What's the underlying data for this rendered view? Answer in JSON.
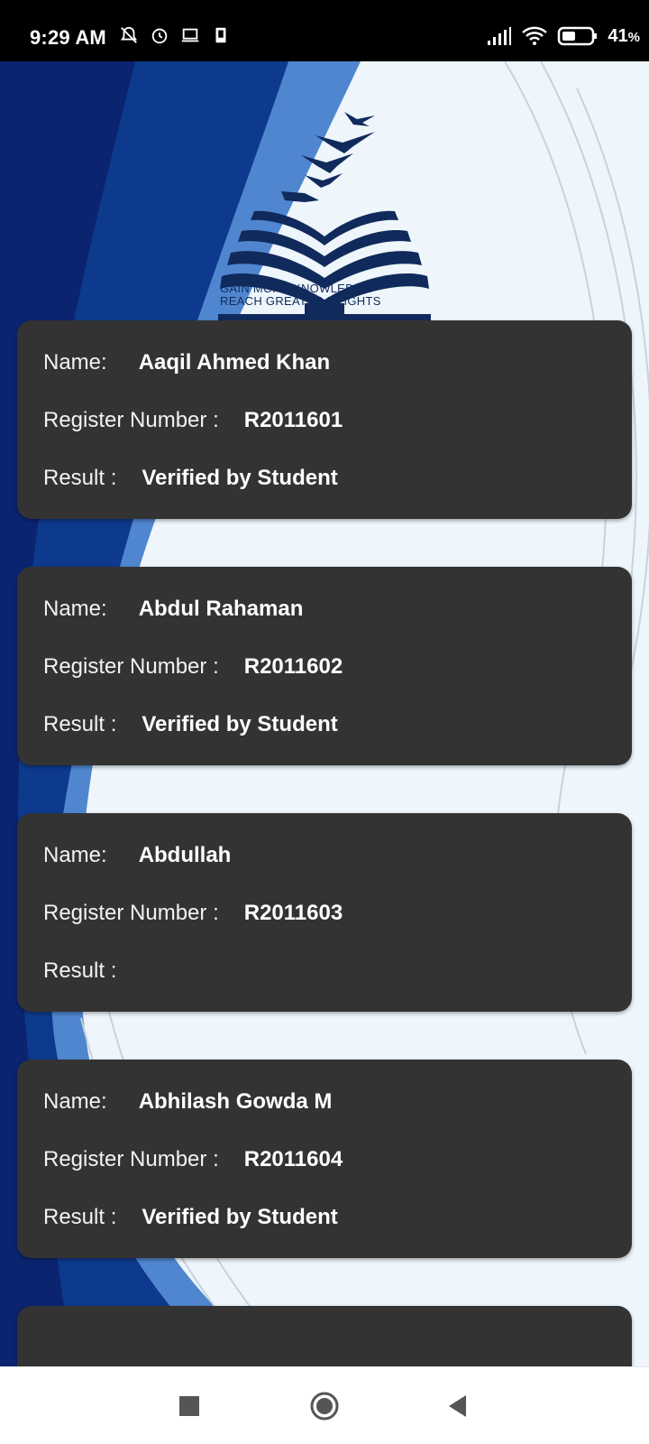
{
  "status_bar": {
    "time": "9:29 AM",
    "battery_percent": "41",
    "icons": [
      "do-not-disturb-icon",
      "alarm-icon",
      "laptop-icon",
      "phone-icon",
      "signal-icon",
      "wifi-icon",
      "battery-icon"
    ]
  },
  "logo": {
    "tagline_line1": "GAIN  MORE  KNOWLEDGE",
    "tagline_line2": "REACH GREATER HEIGHTS"
  },
  "labels": {
    "name": "Name:",
    "register_number": "Register Number :",
    "result": "Result  :"
  },
  "students": [
    {
      "name": "Aaqil Ahmed Khan",
      "register_number": "R2011601",
      "result": "Verified by Student"
    },
    {
      "name": "Abdul Rahaman",
      "register_number": "R2011602",
      "result": "Verified by Student"
    },
    {
      "name": "Abdullah",
      "register_number": "R2011603",
      "result": ""
    },
    {
      "name": "Abhilash Gowda M",
      "register_number": "R2011604",
      "result": "Verified by Student"
    }
  ],
  "colors": {
    "card": "#333333",
    "brand_blue": "#0d3a8c",
    "accent_blue": "#4f86cf"
  },
  "nav_bar": {
    "icons": [
      "recents-icon",
      "home-icon",
      "back-icon"
    ]
  }
}
